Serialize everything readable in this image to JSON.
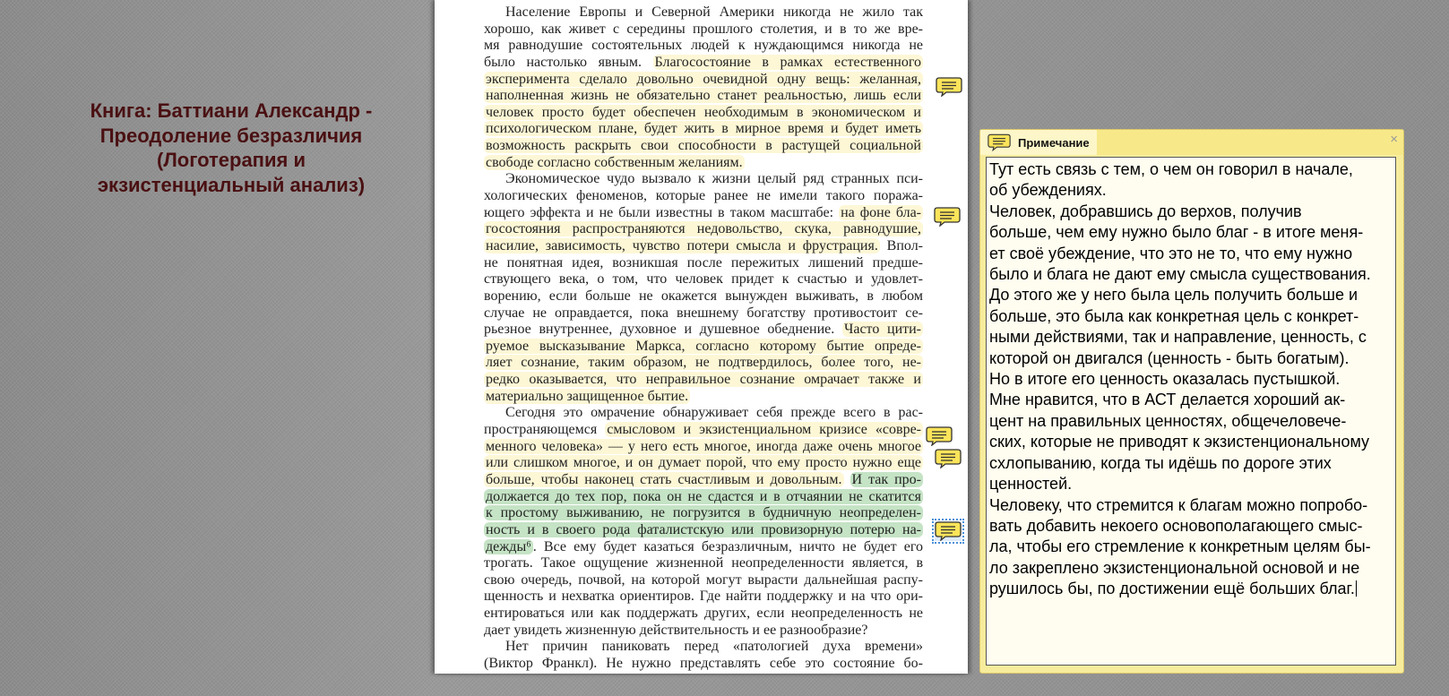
{
  "book_title": [
    "Книга: Баттиани Александр -",
    "Преодоление безразличия",
    "(Логотерапия и",
    "экзистенциальный анализ)"
  ],
  "page_lines": [
    {
      "s": [
        [
          "Население Европы и Северной Америки никогда не жило так",
          ""
        ]
      ],
      "ind": true
    },
    {
      "s": [
        [
          "хорошо, как живет с середины прошлого столетия, и в то же вре-",
          ""
        ]
      ]
    },
    {
      "s": [
        [
          "мя равнодушие состоятельных людей к нуждающимся никогда не",
          ""
        ]
      ]
    },
    {
      "s": [
        [
          "было настолько явным. ",
          ""
        ],
        [
          "Благосостояние в рамках естественного",
          "y"
        ]
      ]
    },
    {
      "s": [
        [
          "эксперимента сделало довольно очевидной одну вещь: желанная,",
          "y"
        ]
      ]
    },
    {
      "s": [
        [
          "наполненная жизнь не обязательно станет реальностью, лишь если",
          "y"
        ]
      ]
    },
    {
      "s": [
        [
          "человек просто будет обеспечен необходимым в экономическом и",
          "y"
        ]
      ]
    },
    {
      "s": [
        [
          "психологическом плане, будет жить в мирное время и будет иметь",
          "y"
        ]
      ]
    },
    {
      "s": [
        [
          "возможность раскрыть свои способности в растущей социальной",
          "y"
        ]
      ]
    },
    {
      "s": [
        [
          "свободе согласно собственным желаниям.",
          "y"
        ]
      ],
      "last": true
    },
    {
      "s": [
        [
          "Экономическое чудо вызвало к жизни целый ряд странных пси-",
          ""
        ]
      ],
      "ind": true
    },
    {
      "s": [
        [
          "хологических феноменов, которые ранее не имели такого поража-",
          ""
        ]
      ]
    },
    {
      "s": [
        [
          "ющего эффекта и не были известны в таком масштабе: ",
          ""
        ],
        [
          "на фоне бла-",
          "y"
        ]
      ]
    },
    {
      "s": [
        [
          "госостояния распространяются недовольство, скука, равнодушие,",
          "y"
        ]
      ]
    },
    {
      "s": [
        [
          "насилие, зависимость, чувство потери смысла и фрустрация.",
          "y"
        ],
        [
          " Впол-",
          ""
        ]
      ]
    },
    {
      "s": [
        [
          "не понятная идея, возникшая после пережитых лишений предше-",
          ""
        ]
      ]
    },
    {
      "s": [
        [
          "ствующего века, о том, что человек придет к счастью и удовлет-",
          ""
        ]
      ]
    },
    {
      "s": [
        [
          "ворению, если больше не окажется вынужден выживать, в любом",
          ""
        ]
      ]
    },
    {
      "s": [
        [
          "случае не оправдается, пока внешнему богатству противостоит се-",
          ""
        ]
      ]
    },
    {
      "s": [
        [
          "рьезное внутреннее, духовное и душевное обеднение. ",
          ""
        ],
        [
          "Часто цити-",
          "y"
        ]
      ]
    },
    {
      "s": [
        [
          "руемое высказывание Маркса, согласно которому бытие опреде-",
          "y"
        ]
      ]
    },
    {
      "s": [
        [
          "ляет сознание, таким образом, не подтвердилось, более того, не-",
          "y"
        ]
      ]
    },
    {
      "s": [
        [
          "редко оказывается, что неправильное сознание омрачает также и",
          "y"
        ]
      ]
    },
    {
      "s": [
        [
          "материально защищенное бытие.",
          "y"
        ]
      ],
      "last": true
    },
    {
      "s": [
        [
          "Сегодня это омрачение обнаруживает себя прежде всего в рас-",
          ""
        ]
      ],
      "ind": true
    },
    {
      "s": [
        [
          "пространяющемся ",
          ""
        ],
        [
          "смысловом и экзистенциальном кризисе «совре-",
          "y"
        ]
      ]
    },
    {
      "s": [
        [
          "менного человека» — у него есть многое, иногда даже очень многое",
          "y"
        ]
      ]
    },
    {
      "s": [
        [
          "или слишком многое, и он думает порой, что ему просто нужно еще",
          "y"
        ]
      ]
    },
    {
      "s": [
        [
          "больше, чтобы наконец стать счастливым и довольным.",
          "y"
        ],
        [
          " ",
          ""
        ],
        [
          "И так про-",
          "g"
        ]
      ]
    },
    {
      "s": [
        [
          "должается до тех пор, пока он не сдастся и в отчаянии не скатится",
          "g"
        ]
      ]
    },
    {
      "s": [
        [
          "к простому выживанию, не погрузится в будничную неопределен-",
          "g"
        ]
      ]
    },
    {
      "s": [
        [
          "ность и в своего рода фаталистскую или провизорную потерю на-",
          "g"
        ]
      ]
    },
    {
      "s": [
        [
          "дежды⁶",
          "g"
        ],
        [
          ". Все ему будет казаться безразличным, ничто не будет его",
          ""
        ]
      ]
    },
    {
      "s": [
        [
          "трогать. Такое ощущение жизненной неопределенности является, в",
          ""
        ]
      ]
    },
    {
      "s": [
        [
          "свою очередь, почвой, на которой могут вырасти дальнейшая распу-",
          ""
        ]
      ]
    },
    {
      "s": [
        [
          "щенность и нехватка ориентиров. Где найти поддержку и на что ори-",
          ""
        ]
      ]
    },
    {
      "s": [
        [
          "ентироваться или как поддержать других, если неопределенность не",
          ""
        ]
      ]
    },
    {
      "s": [
        [
          "дает увидеть жизненную действительность и ее разнообразие?",
          ""
        ]
      ],
      "last": true
    },
    {
      "s": [
        [
          "Нет причин паниковать перед «патологией духа времени»",
          ""
        ]
      ],
      "ind": true
    },
    {
      "s": [
        [
          "(Виктор Франкл). Не нужно представлять себе это состояние бо-",
          ""
        ]
      ]
    }
  ],
  "note": {
    "title": "Примечание",
    "close_label": "×",
    "lines": [
      "Тут есть связь с тем, о чем он говорил в начале,",
      "об убеждениях.",
      "Человек, добравшись до верхов, получив",
      "больше, чем ему нужно было благ - в итоге меня-",
      "ет своё убеждение, что это не то, что ему нужно",
      "было и блага не дают ему смысла существования.",
      "До этого же у него была цель получить больше и",
      "больше, это была как конкретная цель с конкрет-",
      "ными действиями, так и направление, ценность, с",
      "которой он двигался (ценность - быть богатым).",
      "Но в итоге его ценность оказалась пустышкой.",
      "Мне нравится, что в АСТ делается хороший ак-",
      "цент на правильных ценностях, общечеловече-",
      "ских, которые не приводят к экзистенциональному",
      "схлопыванию, когда ты идёшь по дороге этих",
      "ценностей.",
      "Человеку, что стремится к благам можно попробо-",
      "вать добавить некоего основополагающего смыс-",
      "ла, чтобы его стремление к конкретным целям бы-",
      "ло закреплено экзистенциональной основой и не",
      "рушилось бы, по достижении ещё больших благ."
    ]
  },
  "colors": {
    "highlight_yellow": "#fdf7d6",
    "highlight_green": "#c5e3c5",
    "note_yellow": "#fce45a",
    "title": "#4a1012"
  }
}
